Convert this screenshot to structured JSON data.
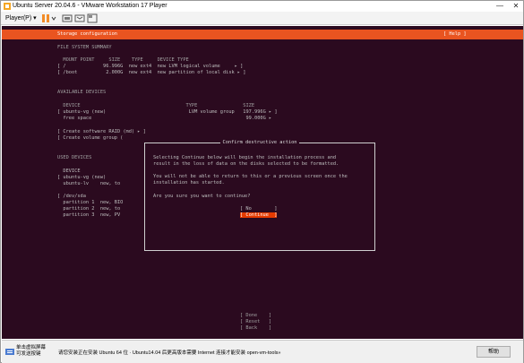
{
  "window": {
    "title": "Ubuntu Server 20.04.6 - VMware Workstation 17 Player",
    "player_menu": "Player(P) ▾",
    "minimize_glyph": "—",
    "maximize_glyph": "☐",
    "close_glyph": "✕"
  },
  "installer": {
    "header_title": "Storage configuration",
    "help": "[ Help ]",
    "fs_summary_heading": "FILE SYSTEM SUMMARY",
    "fs_columns": "  MOUNT POINT     SIZE    TYPE     DEVICE TYPE",
    "fs_rows": [
      "[ /             96.996G  new ext4  new LVM logical volume     ▸ ]",
      "[ /boot          2.000G  new ext4  new partition of local disk ▸ ]"
    ],
    "available_heading": "AVAILABLE DEVICES",
    "avail_columns": "  DEVICE                                     TYPE                SIZE",
    "avail_rows": [
      "[ ubuntu-vg (new)                             LVM volume group   197.996G ▸ ]",
      "  free space                                                      99.000G ▸"
    ],
    "avail_actions": [
      "[ Create software RAID (md) ▸ ]",
      "[ Create volume group (     "
    ],
    "used_heading": "USED DEVICES",
    "used_lines": [
      "  DEVICE",
      "[ ubuntu-vg (new)",
      "  ubuntu-lv    new, to",
      "",
      "[ /dev/sda",
      "  partition 1  new, BIO",
      "  partition 2  new, to",
      "  partition 3  new, PV"
    ],
    "bottom_buttons": [
      "[ Done    ]",
      "[ Reset   ]",
      "[ Back    ]"
    ]
  },
  "dialog": {
    "title": "Confirm destructive action",
    "line1": "Selecting Continue below will begin the installation process and",
    "line2": "result in the loss of data on the disks selected to be formatted.",
    "line3": "You will not be able to return to this or a previous screen once the",
    "line4": "installation has started.",
    "question": "Are you sure you want to continue?",
    "no_label": "[ No        ]",
    "continue_label": "[ Continue  ]"
  },
  "statusbar": {
    "left_line1": "单击虚拟屏幕",
    "left_line2": "可发送按键",
    "message": "请您安装正在安装 Ubuntu 64 位 · Ubuntu14.04 后更高版本需要 Internet 连接才能安装 open-vm-tools»",
    "help_label": "帮助"
  },
  "colors": {
    "accent": "#e95420",
    "selected": "#e53a00",
    "terminal_bg": "#2b0a1f"
  }
}
